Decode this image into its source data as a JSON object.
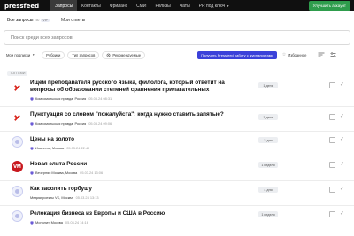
{
  "brand": {
    "name": "pressfeed"
  },
  "nav": {
    "items": [
      {
        "label": "Запросы",
        "active": true
      },
      {
        "label": "Контакты"
      },
      {
        "label": "Фриланс"
      },
      {
        "label": "СМИ"
      },
      {
        "label": "Релизы"
      },
      {
        "label": "Чаты"
      },
      {
        "label": "PR под ключ"
      }
    ],
    "cta_label": "Улучшить аккаунт"
  },
  "tabs": {
    "all_label": "Все запросы",
    "all_count": "50",
    "all_badge": "VIP",
    "mine_label": "Мои ответы"
  },
  "search": {
    "placeholder": "Поиск среди всех запросов"
  },
  "filters": {
    "subs_label": "Мои подписки",
    "rubrics_label": "Рубрики",
    "types_label": "Тип запросов",
    "recommended_label": "Рекомендуемые",
    "promo_label": "Получить Pressfeed работу с журналистами",
    "favorites_label": "Избранное"
  },
  "top_badge": "ТОП СМИ",
  "requests": [
    {
      "title": "Ищем преподавателя русского языка, филолога, который ответит на вопросы об образовании степеней сравнения прилагательных",
      "publication": "Комсомольская правда, Россия",
      "date": "05.03.24 08:31",
      "days": "1 день",
      "icon": "kp-logo",
      "icon_color": "#d9241b"
    },
    {
      "title": "Пунктуация со словом \"пожалуйста\": когда нужно ставить запятые?",
      "publication": "Комсомольская правда, Россия",
      "date": "05.03.24 09:06",
      "days": "1 день",
      "icon": "kp-logo",
      "icon_color": "#d9241b"
    },
    {
      "title": "Цены на золото",
      "publication": "Известия, Москва",
      "date": "05.03.24 22:40",
      "days": "2 дня",
      "icon": "generic-publication-icon",
      "icon_color": "#b9bde8"
    },
    {
      "title": "Новая элита России",
      "publication": "Вечерняя Москва, Москва",
      "date": "05.03.24 13:06",
      "days": "1 неделя",
      "icon": "vm-logo",
      "icon_color": "#c8181e"
    },
    {
      "title": "Как засолить горбушу",
      "publication": "Медиапроекты VK, Москва",
      "date": "05.03.24 13:13",
      "days": "4 дня",
      "icon": "generic-publication-icon",
      "icon_color": "#b9bde8"
    },
    {
      "title": "Релокация бизнеса из Европы и США в Россию",
      "publication": "Монолит, Москва",
      "date": "05.03.24 14:16",
      "days": "1 неделя",
      "icon": "generic-publication-icon",
      "icon_color": "#b9bde8"
    }
  ]
}
